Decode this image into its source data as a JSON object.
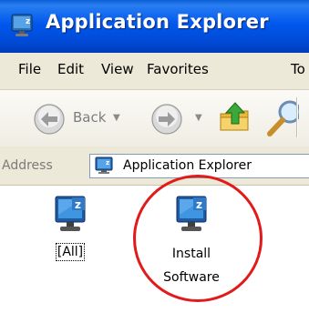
{
  "window": {
    "title": "Application Explorer",
    "icon": "monitor-z-icon"
  },
  "menu": {
    "items": [
      "File",
      "Edit",
      "View",
      "Favorites",
      "To"
    ]
  },
  "toolbar": {
    "back_label": "Back",
    "icons": [
      "back-arrow-icon",
      "forward-arrow-icon",
      "up-folder-icon",
      "search-icon"
    ]
  },
  "address": {
    "label": "Address",
    "value": "Application Explorer"
  },
  "items": [
    {
      "label": "[All]",
      "icon": "monitor-z-icon",
      "selected": true
    },
    {
      "label_line1": "Install",
      "label_line2": "Software",
      "icon": "monitor-z-icon",
      "selected": false
    }
  ],
  "colors": {
    "titlebar": "#0058ee",
    "highlight": "#e21a1a"
  }
}
